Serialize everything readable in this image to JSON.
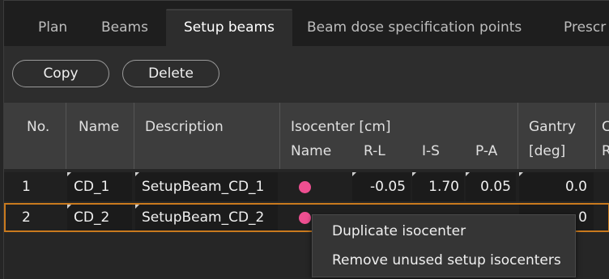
{
  "tabs": [
    {
      "label": "Plan",
      "active": false
    },
    {
      "label": "Beams",
      "active": false
    },
    {
      "label": "Setup beams",
      "active": true
    },
    {
      "label": "Beam dose specification points",
      "active": false
    },
    {
      "label": "Prescr",
      "active": false
    }
  ],
  "toolbar": {
    "copy_label": "Copy",
    "delete_label": "Delete"
  },
  "table": {
    "headers": {
      "no": "No.",
      "name": "Name",
      "description": "Description",
      "isocenter_group": "Isocenter [cm]",
      "iso_name": "Name",
      "rl": "R-L",
      "is": "I-S",
      "pa": "P-A",
      "gantry_line1": "Gantry",
      "gantry_line2": "[deg]",
      "next_col_line1": "C",
      "next_col_line2": "R"
    },
    "rows": [
      {
        "no": "1",
        "name": "CD_1",
        "description": "SetupBeam_CD_1",
        "iso_color": "#ee4f91",
        "rl": "-0.05",
        "is": "1.70",
        "pa": "0.05",
        "gantry": "0.0",
        "selected": false
      },
      {
        "no": "2",
        "name": "CD_2",
        "description": "SetupBeam_CD_2",
        "iso_color": "#ee4f91",
        "gantry": "0",
        "selected": true
      }
    ]
  },
  "context_menu": {
    "items": [
      "Duplicate isocenter",
      "Remove unused setup isocenters"
    ]
  },
  "colors": {
    "selection": "#c97a1e",
    "isocenter": "#ee4f91",
    "background": "#262626"
  }
}
